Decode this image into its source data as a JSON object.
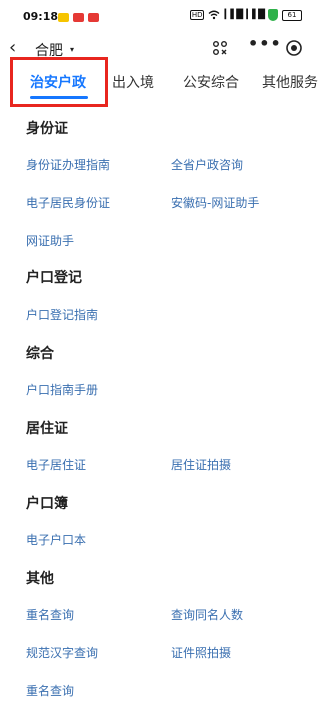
{
  "status": {
    "time": "09:18",
    "hd": "HD",
    "net": "5G",
    "signal1": "▎▌█",
    "signal2": "▎▌█",
    "battery": "61"
  },
  "nav": {
    "back_icon": "‹",
    "city": "合肥",
    "caret": "▾",
    "more": "•••"
  },
  "tabs": [
    {
      "label": "治安户政"
    },
    {
      "label": "出入境"
    },
    {
      "label": "公安综合"
    },
    {
      "label": "其他服务"
    }
  ],
  "sections": [
    {
      "title": "身份证",
      "links": [
        "身份证办理指南",
        "全省户政咨询",
        "电子居民身份证",
        "安徽码-网证助手",
        "网证助手"
      ]
    },
    {
      "title": "户口登记",
      "links": [
        "户口登记指南"
      ]
    },
    {
      "title": "综合",
      "links": [
        "户口指南手册"
      ]
    },
    {
      "title": "居住证",
      "links": [
        "电子居住证",
        "居住证拍摄"
      ]
    },
    {
      "title": "户口簿",
      "links": [
        "电子户口本"
      ]
    },
    {
      "title": "其他",
      "links": [
        "重名查询",
        "查询同名人数",
        "规范汉字查询",
        "证件照拍摄",
        "重名查询"
      ]
    }
  ],
  "colors": {
    "accent": "#1677ff",
    "link": "#3a6fb0",
    "highlight": "#e8261f"
  }
}
